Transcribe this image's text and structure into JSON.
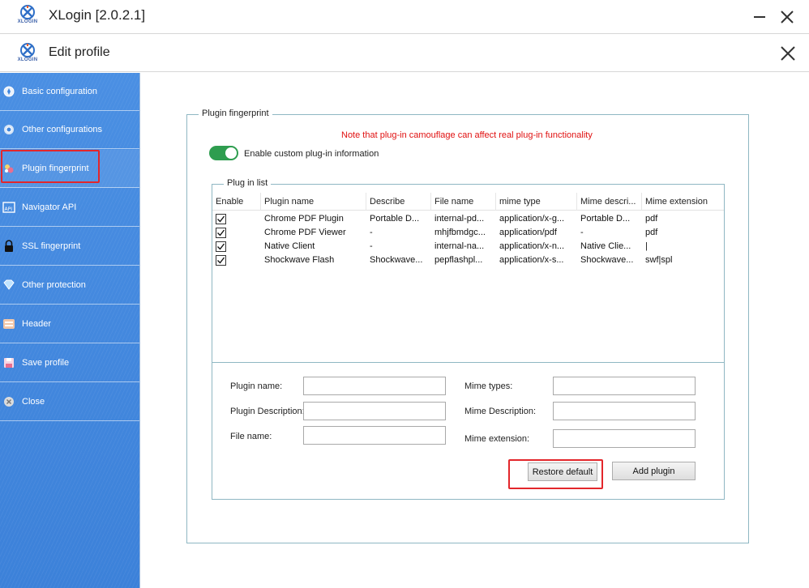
{
  "app": {
    "title": "XLogin [2.0.2.1]",
    "logo_text": "XLOGIN"
  },
  "window_controls": {
    "minimize_icon": "minus-icon",
    "close_icon": "close-icon"
  },
  "dialog": {
    "title": "Edit profile",
    "close_icon": "close-icon"
  },
  "sidebar": {
    "items": [
      {
        "label": "Basic configuration",
        "icon": "compass-icon"
      },
      {
        "label": "Other configurations",
        "icon": "chrome-icon"
      },
      {
        "label": "Plugin fingerprint",
        "icon": "plugin-icon",
        "active": true
      },
      {
        "label": "Navigator API",
        "icon": "api-icon"
      },
      {
        "label": "SSL fingerprint",
        "icon": "lock-icon"
      },
      {
        "label": "Other protection",
        "icon": "shield-icon"
      },
      {
        "label": "Header",
        "icon": "header-icon"
      },
      {
        "label": "Save profile",
        "icon": "save-icon"
      },
      {
        "label": "Close",
        "icon": "close-circle-icon"
      }
    ]
  },
  "plugin": {
    "group_title": "Plugin fingerprint",
    "warning": "Note that plug-in camouflage can affect real plug-in functionality",
    "toggle": {
      "label": "Enable custom plug-in information",
      "on": true,
      "color": "#2e9d4f"
    },
    "list": {
      "title": "Plug in list",
      "columns": [
        "Enable",
        "Plugin name",
        "Describe",
        "File name",
        "mime type",
        "Mime descri...",
        "Mime extension"
      ],
      "rows": [
        {
          "enabled": true,
          "name": "Chrome PDF Plugin",
          "describe": "Portable D...",
          "file": "internal-pd...",
          "mime": "application/x-g...",
          "mime_desc": "Portable D...",
          "ext": "pdf"
        },
        {
          "enabled": true,
          "name": "Chrome PDF Viewer",
          "describe": "-",
          "file": "mhjfbmdgc...",
          "mime": "application/pdf",
          "mime_desc": "-",
          "ext": "pdf"
        },
        {
          "enabled": true,
          "name": "Native Client",
          "describe": "-",
          "file": "internal-na...",
          "mime": "application/x-n...",
          "mime_desc": "Native Clie...",
          "ext": "|"
        },
        {
          "enabled": true,
          "name": "Shockwave Flash",
          "describe": "Shockwave...",
          "file": "pepflashpl...",
          "mime": "application/x-s...",
          "mime_desc": "Shockwave...",
          "ext": "swf|spl"
        }
      ]
    },
    "form": {
      "plugin_name_label": "Plugin name:",
      "plugin_desc_label": "Plugin Description:",
      "file_name_label": "File name:",
      "mime_types_label": "Mime types:",
      "mime_desc_label": "Mime Description:",
      "mime_ext_label": "Mime extension:",
      "plugin_name_value": "",
      "plugin_desc_value": "",
      "file_name_value": "",
      "mime_types_value": "",
      "mime_desc_value": "",
      "mime_ext_value": ""
    },
    "buttons": {
      "restore": "Restore default",
      "add": "Add plugin"
    }
  },
  "colors": {
    "highlight": "#e3262b",
    "warning": "#e01010",
    "sidebar": "#3f86de",
    "group_border": "#8fb7c3"
  }
}
